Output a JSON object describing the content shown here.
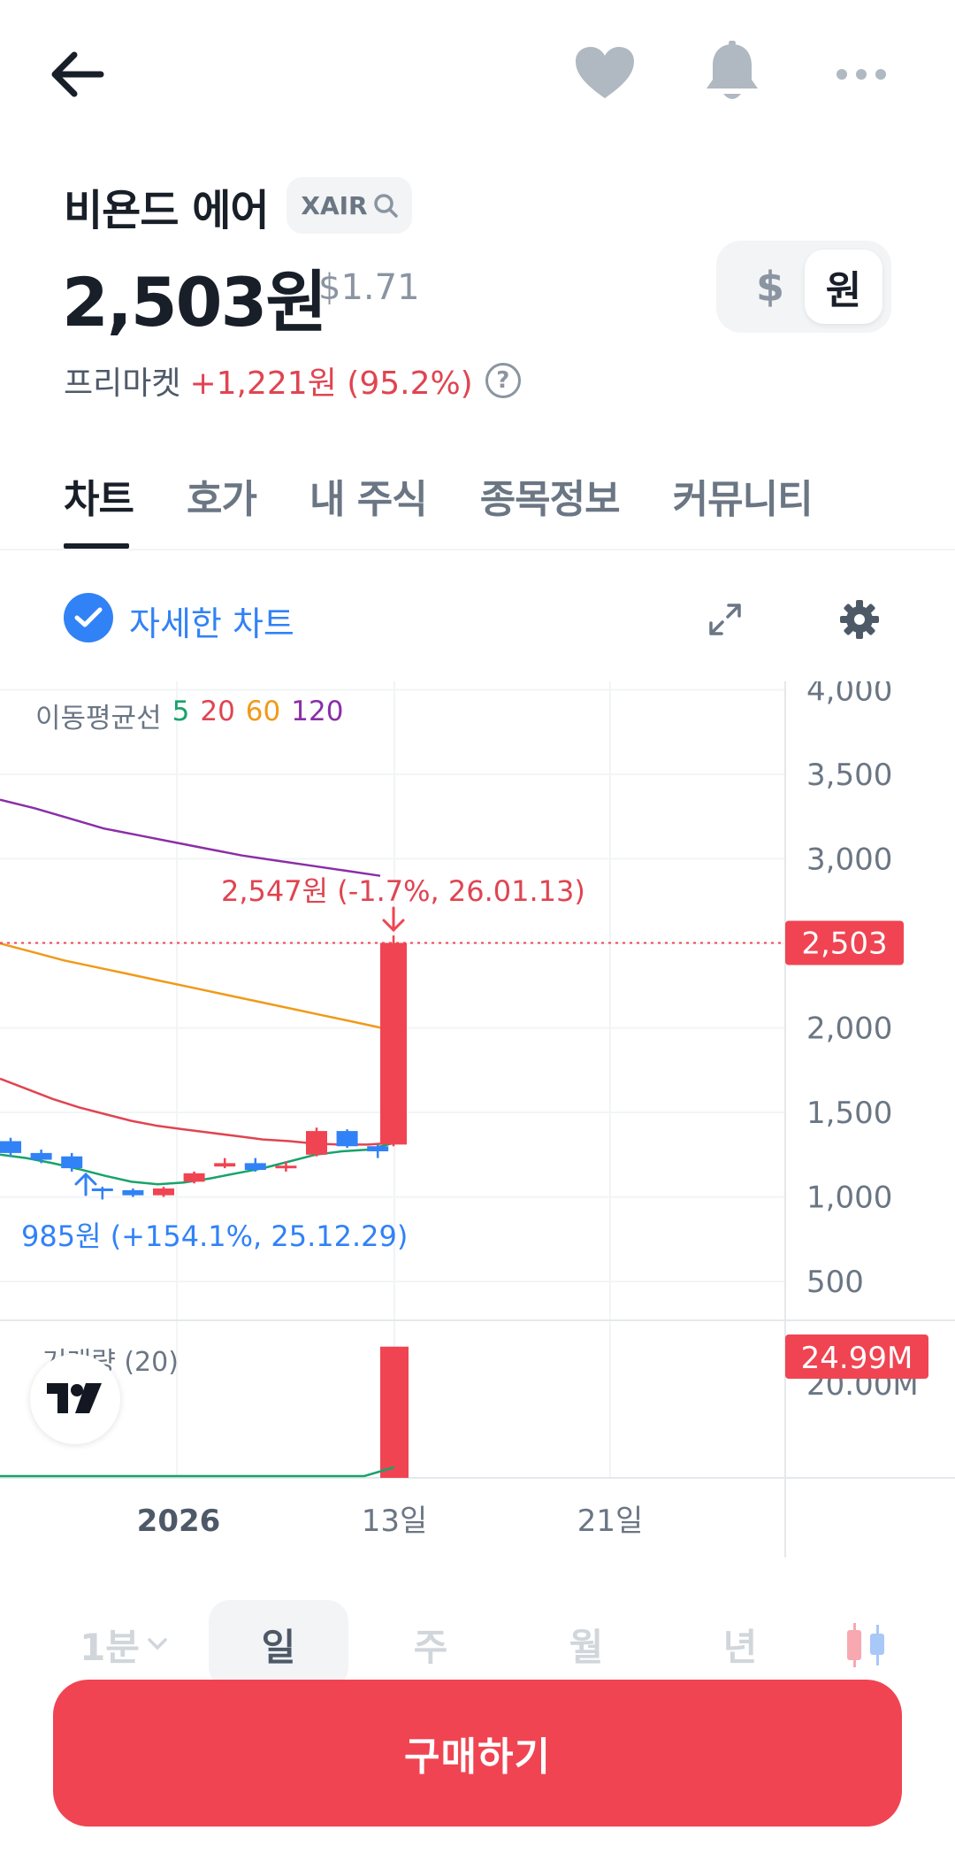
{
  "header": {
    "back_icon": "arrow-left-icon",
    "favorite_icon": "heart-icon",
    "alarm_icon": "bell-icon",
    "more_icon": "more-dots-icon"
  },
  "stock": {
    "name": "비욘드 에어",
    "ticker": "XAIR",
    "price": "2,503원",
    "price_usd": "$1.71",
    "premarket_label": "프리마켓",
    "premarket_change": "+1,221원 (95.2%)",
    "currency_dollar": "$",
    "currency_won": "원"
  },
  "tabs": [
    "차트",
    "호가",
    "내 주식",
    "종목정보",
    "커뮤니티"
  ],
  "chart_header": {
    "detail_label": "자세한 차트",
    "expand_icon": "expand-icon",
    "settings_icon": "gear-icon"
  },
  "colors": {
    "up": "#f04452",
    "down": "#3182f6",
    "ma5": "#17a36b",
    "ma20": "#e04451",
    "ma60": "#f09a1a",
    "ma120": "#8a2fa8"
  },
  "chart_data": {
    "type": "candlestick",
    "ma_label": "이동평균선",
    "ma_periods": [
      "5",
      "20",
      "60",
      "120"
    ],
    "y_ticks": [
      "4,000",
      "3,500",
      "3,000",
      "2,500",
      "2,000",
      "1,500",
      "1,000",
      "500"
    ],
    "y_tick_values": [
      4000,
      3500,
      3000,
      2500,
      2000,
      1500,
      1000,
      500
    ],
    "ylim": [
      270,
      4050
    ],
    "x_labels": [
      "2026",
      "13일",
      "21일"
    ],
    "current_price": 2503,
    "current_price_label": "2,503",
    "high_annotation": "2,547원 (-1.7%, 26.01.13)",
    "low_annotation": "985원 (+154.1%, 25.12.29)",
    "candles": [
      {
        "o": 1330,
        "c": 1260,
        "h": 1350,
        "l": 1240
      },
      {
        "o": 1260,
        "c": 1220,
        "h": 1280,
        "l": 1200
      },
      {
        "o": 1240,
        "c": 1170,
        "h": 1260,
        "l": 1150
      },
      {
        "o": 1050,
        "c": 1040,
        "h": 1060,
        "l": 985
      },
      {
        "o": 1040,
        "c": 1010,
        "h": 1050,
        "l": 1000
      },
      {
        "o": 1010,
        "c": 1050,
        "h": 1060,
        "l": 1000
      },
      {
        "o": 1090,
        "c": 1140,
        "h": 1150,
        "l": 1080
      },
      {
        "o": 1180,
        "c": 1200,
        "h": 1230,
        "l": 1170
      },
      {
        "o": 1200,
        "c": 1160,
        "h": 1230,
        "l": 1150
      },
      {
        "o": 1180,
        "c": 1185,
        "h": 1210,
        "l": 1150
      },
      {
        "o": 1250,
        "c": 1390,
        "h": 1410,
        "l": 1240
      },
      {
        "o": 1390,
        "c": 1300,
        "h": 1400,
        "l": 1290
      },
      {
        "o": 1300,
        "c": 1270,
        "h": 1310,
        "l": 1230
      },
      {
        "o": 1310,
        "c": 2503,
        "h": 2547,
        "l": 1300
      }
    ],
    "ma5": [
      1250,
      1230,
      1200,
      1165,
      1125,
      1090,
      1075,
      1085,
      1110,
      1140,
      1170,
      1210,
      1250,
      1270,
      1280,
      1320
    ],
    "ma20": [
      1700,
      1640,
      1580,
      1530,
      1490,
      1450,
      1420,
      1400,
      1380,
      1360,
      1340,
      1330,
      1315,
      1310,
      1310,
      1320
    ],
    "ma60": [
      2500,
      2450,
      2400,
      2360,
      2320,
      2280,
      2240,
      2200,
      2160,
      2120,
      2080,
      2040,
      2000
    ],
    "ma120": [
      3350,
      3300,
      3240,
      3180,
      3140,
      3100,
      3060,
      3020,
      2990,
      2960,
      2930,
      2900
    ],
    "volume_label": "거래량 (20)",
    "volume_tick": "20.00M",
    "volume_current": "24.99M",
    "volume_last": 24.99,
    "volume_max": 30
  },
  "periods": {
    "minute": "1분",
    "day": "일",
    "week": "주",
    "month": "월",
    "year": "년"
  },
  "buy_button": "구매하기"
}
